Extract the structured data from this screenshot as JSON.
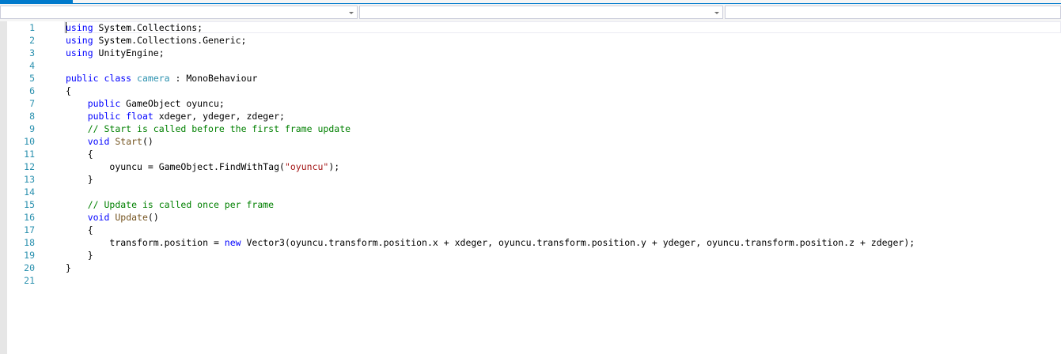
{
  "navbar": {
    "project_dropdown": "",
    "type_dropdown": "",
    "member_dropdown": ""
  },
  "line_numbers": [
    "1",
    "2",
    "3",
    "4",
    "5",
    "6",
    "7",
    "8",
    "9",
    "10",
    "11",
    "12",
    "13",
    "14",
    "15",
    "16",
    "17",
    "18",
    "19",
    "20",
    "21"
  ],
  "code": {
    "l1": {
      "kw": "using",
      "rest": " System.Collections;"
    },
    "l2": {
      "kw": "using",
      "rest": " System.Collections.Generic;"
    },
    "l3": {
      "kw": "using",
      "rest": " UnityEngine;"
    },
    "l5": {
      "kw1": "public",
      "kw2": "class",
      "cls": "camera",
      "rest": " : MonoBehaviour"
    },
    "l6": "{",
    "l7": {
      "indent": "    ",
      "kw": "public",
      "rest": " GameObject oyuncu;"
    },
    "l8": {
      "indent": "    ",
      "kw1": "public",
      "kw2": "float",
      "rest": " xdeger, ydeger, zdeger;"
    },
    "l9": {
      "indent": "    ",
      "comment": "// Start is called before the first frame update"
    },
    "l10": {
      "indent": "    ",
      "kw": "void",
      "fn": "Start",
      "rest": "()"
    },
    "l11": "    {",
    "l12": {
      "indent": "        ",
      "pre": "oyuncu = GameObject.FindWithTag(",
      "str": "\"oyuncu\"",
      "post": ");"
    },
    "l13": "    }",
    "l15": {
      "indent": "    ",
      "comment": "// Update is called once per frame"
    },
    "l16": {
      "indent": "    ",
      "kw": "void",
      "fn": "Update",
      "rest": "()"
    },
    "l17": "    {",
    "l18": {
      "indent": "        ",
      "pre": "transform.position = ",
      "kw": "new",
      "post": " Vector3(oyuncu.transform.position.x + xdeger, oyuncu.transform.position.y + ydeger, oyuncu.transform.position.z + zdeger);"
    },
    "l19": "    }",
    "l20": "}"
  },
  "colors": {
    "keyword": "#0000ff",
    "type": "#2b91af",
    "comment": "#008000",
    "string": "#a31515",
    "method": "#74531f",
    "line_number": "#2b91af",
    "accent": "#007acc"
  }
}
